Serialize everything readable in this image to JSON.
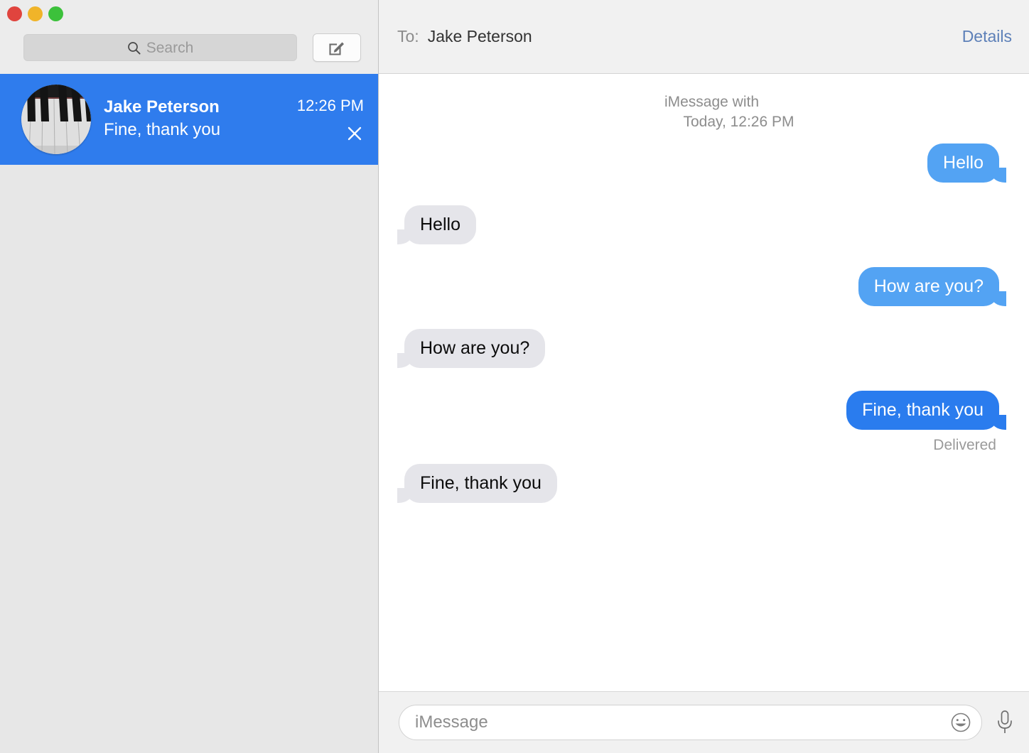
{
  "window": {
    "traffic_lights": {
      "close_label": "close-window",
      "minimize_label": "minimize-window",
      "zoom_label": "zoom-window",
      "close_color": "#e0443e",
      "minimize_color": "#f0b429",
      "zoom_color": "#3cc13b"
    }
  },
  "sidebar": {
    "search": {
      "placeholder": "Search",
      "value": "",
      "icon": "search-icon"
    },
    "compose": {
      "icon": "compose-icon",
      "label": "New Message"
    },
    "conversations": [
      {
        "name": "Jake Peterson",
        "preview": "Fine, thank you",
        "time": "12:26 PM",
        "selected": true,
        "avatar": "piano-keys-photo",
        "close_icon": "close-icon"
      }
    ]
  },
  "header": {
    "to_label": "To:",
    "recipient": "Jake Peterson",
    "details_label": "Details",
    "details_color": "#5d80b8"
  },
  "thread": {
    "meta_line1": "iMessage with",
    "meta_line2": "Today, 12:26 PM",
    "messages": [
      {
        "text": "Hello",
        "direction": "out",
        "style": "light"
      },
      {
        "text": "Hello",
        "direction": "in",
        "style": "gray"
      },
      {
        "text": "How are you?",
        "direction": "out",
        "style": "light"
      },
      {
        "text": "How are you?",
        "direction": "in",
        "style": "gray"
      },
      {
        "text": "Fine, thank you",
        "direction": "out",
        "style": "deep"
      },
      {
        "text": "Fine, thank you",
        "direction": "in",
        "style": "gray"
      }
    ],
    "delivered_label": "Delivered",
    "bubble_out_color": "#53a3f3",
    "bubble_out_deep_color": "#2a7cee",
    "bubble_in_color": "#e5e5ea"
  },
  "composer": {
    "placeholder": "iMessage",
    "value": "",
    "emoji_icon": "smiley-icon",
    "mic_icon": "microphone-icon"
  }
}
